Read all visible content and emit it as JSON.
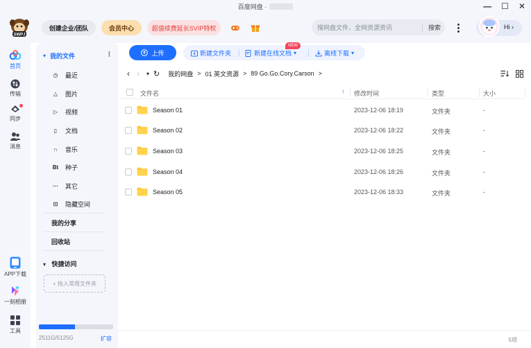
{
  "window": {
    "title": "百度网盘 ·",
    "controls": [
      "—",
      "☐",
      "✕"
    ]
  },
  "header": {
    "team_button": "创建企业/团队",
    "vip_button": "会员中心",
    "svip_button": "超值续费延长SVIP特权",
    "search_placeholder": "搜网盘文件、全网资源资讯",
    "search_button": "搜索",
    "greeting": "Hi",
    "greeting_chevron": "›",
    "logo_text": "SWPJ"
  },
  "leftnav": {
    "items": [
      {
        "label": "首页",
        "icon": "home-icon"
      },
      {
        "label": "传输",
        "icon": "transfer-icon"
      },
      {
        "label": "同步",
        "icon": "sync-icon"
      },
      {
        "label": "消息",
        "icon": "message-icon"
      },
      {
        "label": "APP下载",
        "icon": "app-download-icon"
      },
      {
        "label": "一刻相册",
        "icon": "photo-album-icon"
      },
      {
        "label": "工具",
        "icon": "tools-icon"
      }
    ]
  },
  "sidebar": {
    "my_files": "我的文件",
    "my_files_toggle": "▾",
    "my_files_menu": "⋮",
    "items": [
      {
        "label": "最近",
        "icon": "clock-icon",
        "glyph": "◷"
      },
      {
        "label": "图片",
        "icon": "image-icon",
        "glyph": "△"
      },
      {
        "label": "视频",
        "icon": "video-icon",
        "glyph": "▷"
      },
      {
        "label": "文档",
        "icon": "document-icon",
        "glyph": "▯"
      },
      {
        "label": "音乐",
        "icon": "music-icon",
        "glyph": "∩"
      },
      {
        "label": "种子",
        "icon": "torrent-icon",
        "glyph": "Bt"
      },
      {
        "label": "其它",
        "icon": "other-icon",
        "glyph": "···"
      },
      {
        "label": "隐藏空间",
        "icon": "lock-icon",
        "glyph": "⊡"
      }
    ],
    "my_share": "我的分享",
    "recycle_bin": "回收站",
    "quick_access": "快捷访问",
    "quick_access_toggle": "▾",
    "add_quick": "+ 拖入常用文件夹",
    "storage_text": "2511G/5125G",
    "storage_used_fraction": 0.49,
    "expand": "扩容"
  },
  "toolbar": {
    "upload": "上传",
    "new_folder": "新建文件夹",
    "new_online_doc": "新建在线文档",
    "new_badge": "NEW",
    "offline_download": "离线下载",
    "dropdown_glyph": "▾"
  },
  "breadcrumb": {
    "back": "‹",
    "forward": "›",
    "dropdown": "▾",
    "refresh": "↻",
    "separator": ">",
    "segments": [
      "我的网盘",
      "01 英文资源",
      "89 Go.Go.Cory.Carson"
    ]
  },
  "table": {
    "columns": {
      "name": "文件名",
      "modified": "修改时间",
      "type": "类型",
      "size": "大小"
    },
    "sort_indicator": "↑",
    "rows": [
      {
        "name": "Season 01",
        "modified": "2023-12-06 18:19",
        "type": "文件夹",
        "size": "-"
      },
      {
        "name": "Season 02",
        "modified": "2023-12-06 18:22",
        "type": "文件夹",
        "size": "-"
      },
      {
        "name": "Season 03",
        "modified": "2023-12-06 18:25",
        "type": "文件夹",
        "size": "-"
      },
      {
        "name": "Season 04",
        "modified": "2023-12-06 18:26",
        "type": "文件夹",
        "size": "-"
      },
      {
        "name": "Season 05",
        "modified": "2023-12-06 18:33",
        "type": "文件夹",
        "size": "-"
      }
    ]
  },
  "footer": {
    "count": "5项"
  },
  "colors": {
    "accent": "#1e6fff",
    "vip": "#fbdfae",
    "svip_text": "#e2403a",
    "folder": "#ffc63a",
    "badge": "#f5455a"
  }
}
